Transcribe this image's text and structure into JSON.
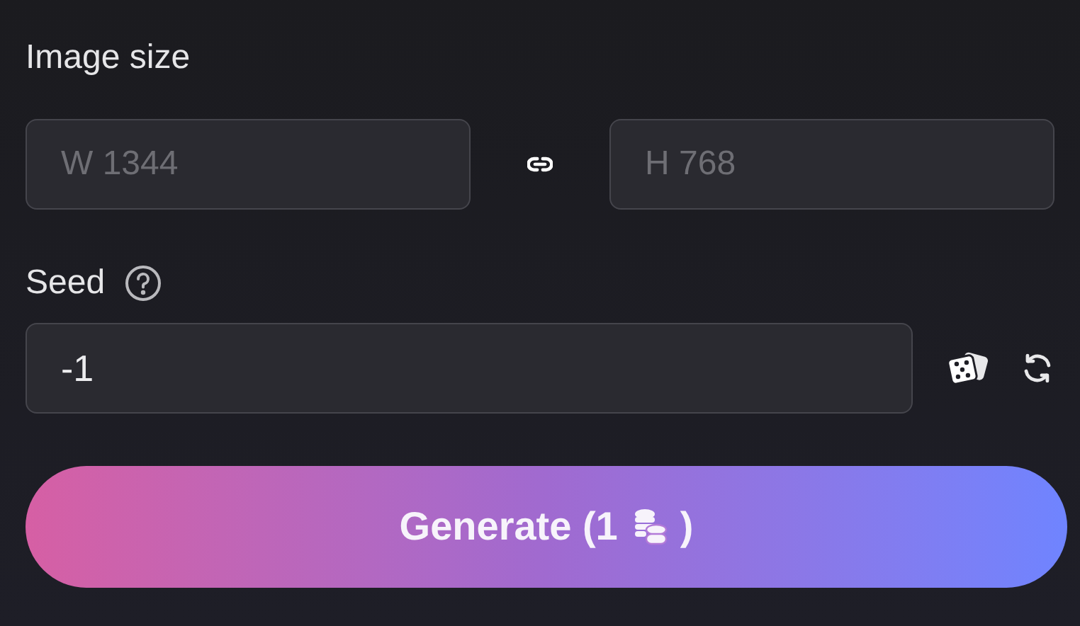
{
  "image_size": {
    "label": "Image size",
    "width_field": {
      "placeholder": "W 1344"
    },
    "height_field": {
      "placeholder": "H 768"
    }
  },
  "seed": {
    "label": "Seed",
    "value": "-1"
  },
  "generate_button": {
    "text_before_icon": "Generate (1",
    "text_after_icon": ")"
  }
}
